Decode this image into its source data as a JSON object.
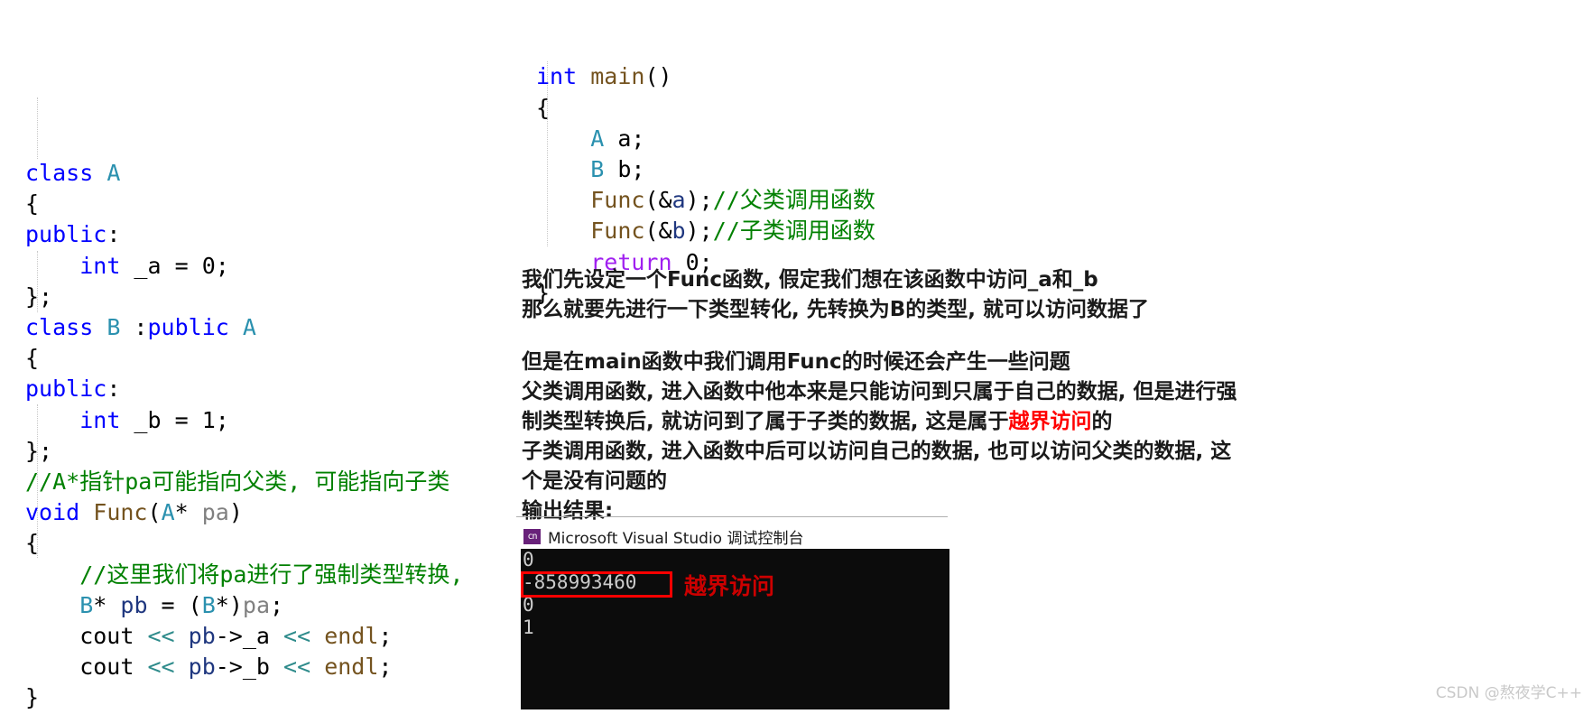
{
  "left_code": {
    "lines": [
      [
        {
          "t": "class ",
          "c": "kw"
        },
        {
          "t": "A",
          "c": "type"
        }
      ],
      [
        {
          "t": "{",
          "c": "plain"
        }
      ],
      [
        {
          "t": "public",
          "c": "kw"
        },
        {
          "t": ":",
          "c": "plain"
        }
      ],
      [
        {
          "t": "    ",
          "c": "plain"
        },
        {
          "t": "int",
          "c": "kw"
        },
        {
          "t": " _a = ",
          "c": "plain"
        },
        {
          "t": "0",
          "c": "num"
        },
        {
          "t": ";",
          "c": "plain"
        }
      ],
      [
        {
          "t": "};",
          "c": "plain"
        }
      ],
      [
        {
          "t": "class ",
          "c": "kw"
        },
        {
          "t": "B",
          "c": "type"
        },
        {
          "t": " :",
          "c": "plain"
        },
        {
          "t": "public",
          "c": "kw"
        },
        {
          "t": " ",
          "c": "plain"
        },
        {
          "t": "A",
          "c": "type"
        }
      ],
      [
        {
          "t": "{",
          "c": "plain"
        }
      ],
      [
        {
          "t": "public",
          "c": "kw"
        },
        {
          "t": ":",
          "c": "plain"
        }
      ],
      [
        {
          "t": "    ",
          "c": "plain"
        },
        {
          "t": "int",
          "c": "kw"
        },
        {
          "t": " _b = ",
          "c": "plain"
        },
        {
          "t": "1",
          "c": "num"
        },
        {
          "t": ";",
          "c": "plain"
        }
      ],
      [
        {
          "t": "};",
          "c": "plain"
        }
      ],
      [
        {
          "t": "//A*指针pa可能指向父类, 可能指向子类",
          "c": "cmt"
        }
      ],
      [
        {
          "t": "void",
          "c": "kw"
        },
        {
          "t": " ",
          "c": "plain"
        },
        {
          "t": "Func",
          "c": "fn"
        },
        {
          "t": "(",
          "c": "plain"
        },
        {
          "t": "A",
          "c": "type"
        },
        {
          "t": "* ",
          "c": "plain"
        },
        {
          "t": "pa",
          "c": "param"
        },
        {
          "t": ")",
          "c": "plain"
        }
      ],
      [
        {
          "t": "{",
          "c": "plain"
        }
      ],
      [
        {
          "t": "    ",
          "c": "plain"
        },
        {
          "t": "//这里我们将pa进行了强制类型转换,",
          "c": "cmt"
        }
      ],
      [
        {
          "t": "    ",
          "c": "plain"
        },
        {
          "t": "B",
          "c": "type"
        },
        {
          "t": "* ",
          "c": "plain"
        },
        {
          "t": "pb",
          "c": "var"
        },
        {
          "t": " = (",
          "c": "plain"
        },
        {
          "t": "B",
          "c": "type"
        },
        {
          "t": "*)",
          "c": "plain"
        },
        {
          "t": "pa",
          "c": "param"
        },
        {
          "t": ";",
          "c": "plain"
        }
      ],
      [
        {
          "t": "    cout ",
          "c": "plain"
        },
        {
          "t": "<<",
          "c": "angle"
        },
        {
          "t": " ",
          "c": "plain"
        },
        {
          "t": "pb",
          "c": "var"
        },
        {
          "t": "->_a ",
          "c": "plain"
        },
        {
          "t": "<<",
          "c": "angle"
        },
        {
          "t": " ",
          "c": "plain"
        },
        {
          "t": "endl",
          "c": "fn"
        },
        {
          "t": ";",
          "c": "plain"
        }
      ],
      [
        {
          "t": "    cout ",
          "c": "plain"
        },
        {
          "t": "<<",
          "c": "angle"
        },
        {
          "t": " ",
          "c": "plain"
        },
        {
          "t": "pb",
          "c": "var"
        },
        {
          "t": "->_b ",
          "c": "plain"
        },
        {
          "t": "<<",
          "c": "angle"
        },
        {
          "t": " ",
          "c": "plain"
        },
        {
          "t": "endl",
          "c": "fn"
        },
        {
          "t": ";",
          "c": "plain"
        }
      ],
      [
        {
          "t": "}",
          "c": "plain"
        }
      ]
    ]
  },
  "right_code": {
    "lines": [
      [
        {
          "t": "int",
          "c": "kw"
        },
        {
          "t": " ",
          "c": "plain"
        },
        {
          "t": "main",
          "c": "fn"
        },
        {
          "t": "()",
          "c": "plain"
        }
      ],
      [
        {
          "t": "{",
          "c": "plain"
        }
      ],
      [
        {
          "t": "    ",
          "c": "plain"
        },
        {
          "t": "A",
          "c": "type"
        },
        {
          "t": " a;",
          "c": "plain"
        }
      ],
      [
        {
          "t": "    ",
          "c": "plain"
        },
        {
          "t": "B",
          "c": "type"
        },
        {
          "t": " b;",
          "c": "plain"
        }
      ],
      [
        {
          "t": "    ",
          "c": "plain"
        },
        {
          "t": "Func",
          "c": "fn"
        },
        {
          "t": "(&",
          "c": "plain"
        },
        {
          "t": "a",
          "c": "var"
        },
        {
          "t": ");",
          "c": "plain"
        },
        {
          "t": "//父类调用函数",
          "c": "cmt"
        }
      ],
      [
        {
          "t": "    ",
          "c": "plain"
        },
        {
          "t": "Func",
          "c": "fn"
        },
        {
          "t": "(&",
          "c": "plain"
        },
        {
          "t": "b",
          "c": "var"
        },
        {
          "t": ");",
          "c": "plain"
        },
        {
          "t": "//子类调用函数",
          "c": "cmt"
        }
      ],
      [
        {
          "t": "    ",
          "c": "plain"
        },
        {
          "t": "return",
          "c": "kw2"
        },
        {
          "t": " ",
          "c": "plain"
        },
        {
          "t": "0",
          "c": "num"
        },
        {
          "t": ";",
          "c": "plain"
        }
      ],
      [
        {
          "t": "}",
          "c": "plain"
        }
      ]
    ]
  },
  "prose": {
    "para1": [
      [
        {
          "t": "我们先设定一个Func函数, 假定我们想在该函数中访问_a和_b",
          "c": "plain"
        }
      ],
      [
        {
          "t": "那么就要先进行一下类型转化, 先转换为B的类型, 就可以访问数据了",
          "c": "plain"
        }
      ]
    ],
    "para2": [
      [
        {
          "t": "但是在main函数中我们调用Func的时候还会产生一些问题",
          "c": "plain"
        }
      ],
      [
        {
          "t": "父类调用函数, 进入函数中他本来是只能访问到只属于自己的数据, 但是进行强",
          "c": "plain"
        }
      ],
      [
        {
          "t": "制类型转换后, 就访问到了属于子类的数据, 这是属于",
          "c": "plain"
        },
        {
          "t": "越界访问",
          "c": "hl-red"
        },
        {
          "t": "的",
          "c": "plain"
        }
      ],
      [
        {
          "t": "子类调用函数, 进入函数中后可以访问自己的数据, 也可以访问父类的数据, 这",
          "c": "plain"
        }
      ],
      [
        {
          "t": "个是没有问题的",
          "c": "plain"
        }
      ],
      [
        {
          "t": "输出结果:",
          "c": "plain"
        }
      ]
    ]
  },
  "console": {
    "icon_label": "cn",
    "title": "Microsoft Visual Studio 调试控制台",
    "lines": [
      "0",
      "-858993460",
      "0",
      "1",
      ""
    ],
    "annotation": "越界访问"
  },
  "watermark": "CSDN @熬夜学C++",
  "colors": {
    "keyword": "#0000ff",
    "return_keyword": "#a020f0",
    "type": "#2b91af",
    "function": "#74531f",
    "comment": "#008000",
    "variable": "#1f377f",
    "highlight_red": "#ff0000",
    "console_bg": "#0c0c0c",
    "console_fg": "#cccccc"
  }
}
